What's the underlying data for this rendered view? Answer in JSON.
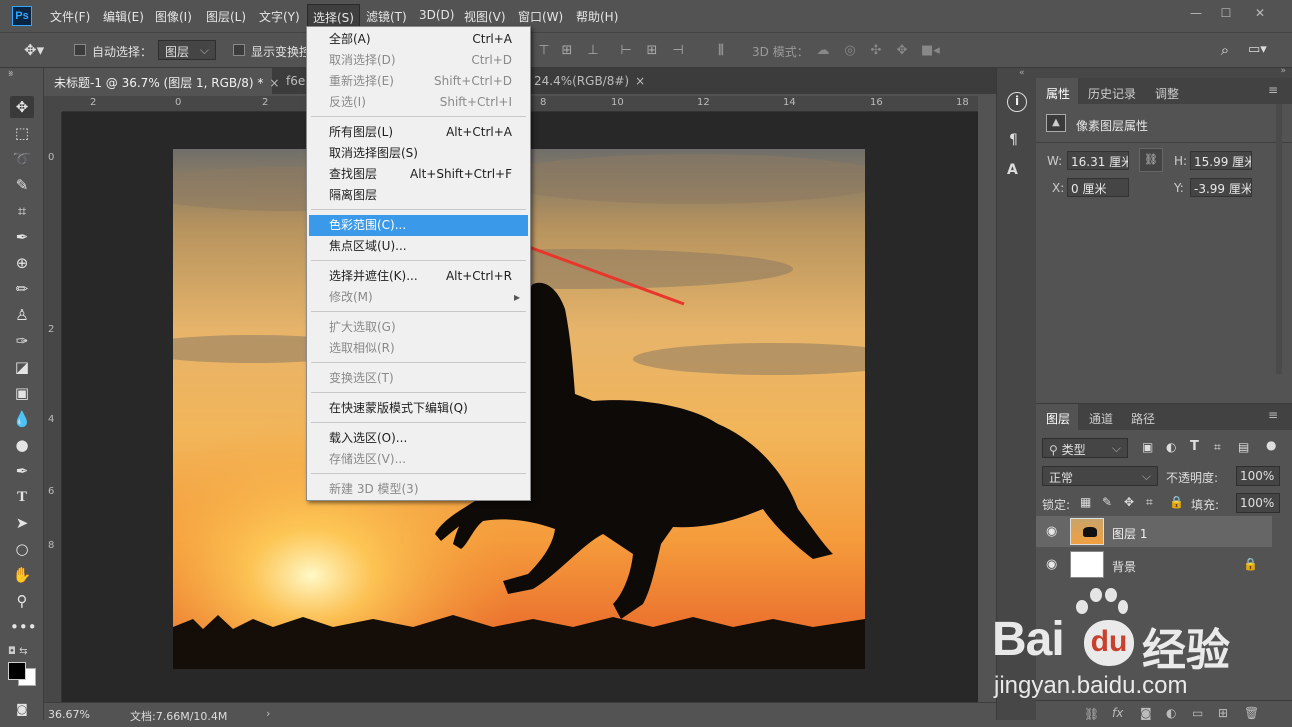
{
  "app": {
    "logo": "Ps"
  },
  "menubar": {
    "items": [
      "文件(F)",
      "编辑(E)",
      "图像(I)",
      "图层(L)",
      "文字(Y)",
      "选择(S)",
      "滤镜(T)",
      "3D(D)",
      "视图(V)",
      "窗口(W)",
      "帮助(H)"
    ],
    "window_controls": [
      "—",
      "☐",
      "✕"
    ]
  },
  "options_bar": {
    "auto_select_label": "自动选择：",
    "auto_select_value": "图层",
    "show_transform_label": "显示变换控",
    "mode_3d_label": "3D 模式："
  },
  "doc_tabs": [
    {
      "label": "未标题-1 @ 36.7% (图层 1, RGB/8) *",
      "close": "×"
    },
    {
      "label": "f6e",
      "close": ""
    },
    {
      "label": "24.4%(RGB/8#)",
      "close": "×"
    }
  ],
  "ruler": {
    "h_ticks": [
      "2",
      "0",
      "2",
      "4",
      "6",
      "8",
      "10",
      "12",
      "14",
      "16",
      "18"
    ],
    "v_ticks": [
      "0",
      "2",
      "4",
      "6",
      "8",
      "9"
    ]
  },
  "dropdown": {
    "items": [
      {
        "label": "全部(A)",
        "shortcut": "Ctrl+A",
        "disabled": false
      },
      {
        "label": "取消选择(D)",
        "shortcut": "Ctrl+D",
        "disabled": true
      },
      {
        "label": "重新选择(E)",
        "shortcut": "Shift+Ctrl+D",
        "disabled": true
      },
      {
        "label": "反选(I)",
        "shortcut": "Shift+Ctrl+I",
        "disabled": true
      },
      {
        "label": "所有图层(L)",
        "shortcut": "Alt+Ctrl+A",
        "disabled": false
      },
      {
        "label": "取消选择图层(S)",
        "shortcut": "",
        "disabled": false
      },
      {
        "label": "查找图层",
        "shortcut": "Alt+Shift+Ctrl+F",
        "disabled": false
      },
      {
        "label": "隔离图层",
        "shortcut": "",
        "disabled": false
      },
      {
        "label": "色彩范围(C)...",
        "shortcut": "",
        "disabled": false
      },
      {
        "label": "焦点区域(U)...",
        "shortcut": "",
        "disabled": false
      },
      {
        "label": "选择并遮住(K)...",
        "shortcut": "Alt+Ctrl+R",
        "disabled": false
      },
      {
        "label": "修改(M)",
        "shortcut": "▸",
        "disabled": true
      },
      {
        "label": "扩大选取(G)",
        "shortcut": "",
        "disabled": true
      },
      {
        "label": "选取相似(R)",
        "shortcut": "",
        "disabled": true
      },
      {
        "label": "变换选区(T)",
        "shortcut": "",
        "disabled": true
      },
      {
        "label": "在快速蒙版模式下编辑(Q)",
        "shortcut": "",
        "disabled": false
      },
      {
        "label": "载入选区(O)...",
        "shortcut": "",
        "disabled": false
      },
      {
        "label": "存储选区(V)...",
        "shortcut": "",
        "disabled": true
      },
      {
        "label": "新建 3D 模型(3)",
        "shortcut": "",
        "disabled": true
      }
    ]
  },
  "properties_panel": {
    "tabs": [
      "属性",
      "历史记录",
      "调整"
    ],
    "title": "像素图层属性",
    "w_label": "W:",
    "w_value": "16.31 厘米",
    "h_label": "H:",
    "h_value": "15.99 厘米",
    "x_label": "X:",
    "x_value": "0 厘米",
    "y_label": "Y:",
    "y_value": "-3.99 厘米"
  },
  "layers_panel": {
    "tabs": [
      "图层",
      "通道",
      "路径"
    ],
    "filter_label": "类型",
    "blend_mode": "正常",
    "opacity_label": "不透明度:",
    "opacity_value": "100%",
    "lock_label": "锁定:",
    "fill_label": "填充:",
    "fill_value": "100%",
    "layers": [
      {
        "name": "图层 1",
        "selected": true
      },
      {
        "name": "背景",
        "selected": false,
        "locked": true
      }
    ]
  },
  "status_bar": {
    "zoom": "36.67%",
    "doc_info": "文档:7.66M/10.4M"
  },
  "watermark": {
    "brand": "Bai",
    "brand2": "du",
    "suffix": "经验",
    "url": "jingyan.baidu.com"
  },
  "colors": {
    "highlight": "#3a99e8",
    "arrow": "#e8362c",
    "panel_bg": "#535353",
    "canvas_bg": "#282828"
  }
}
